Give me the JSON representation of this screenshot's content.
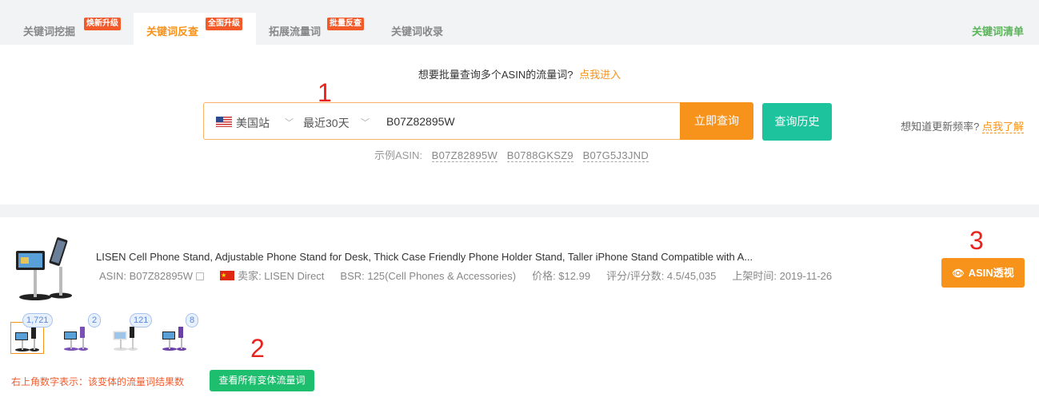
{
  "tabs": [
    {
      "label": "关键词挖掘",
      "badge": "焕新升级"
    },
    {
      "label": "关键词反查",
      "badge": "全面升级",
      "active": true
    },
    {
      "label": "拓展流量词",
      "badge": "批量反查"
    },
    {
      "label": "关键词收录"
    }
  ],
  "keyword_list_link": "关键词清单",
  "batch_tip": {
    "text": "想要批量查询多个ASIN的流量词?",
    "link": "点我进入"
  },
  "search": {
    "site": "美国站",
    "range": "最近30天",
    "asin_value": "B07Z82895W",
    "query_button": "立即查询",
    "history_button": "查询历史"
  },
  "freq_tip": {
    "text": "想知道更新频率?",
    "link": "点我了解"
  },
  "examples": {
    "label": "示例ASIN:",
    "items": [
      "B07Z82895W",
      "B0788GKSZ9",
      "B07G5J3JND"
    ]
  },
  "annotations": [
    "1",
    "2",
    "3"
  ],
  "product": {
    "title": "LISEN Cell Phone Stand, Adjustable Phone Stand for Desk, Thick Case Friendly Phone Holder Stand, Taller iPhone Stand Compatible with A...",
    "asin": "ASIN: B07Z82895W",
    "seller": "卖家: LISEN Direct",
    "bsr": "BSR: 125(Cell Phones & Accessories)",
    "price": "价格: $12.99",
    "rating": "评分/评分数: 4.5/45,035",
    "listed": "上架时间: 2019-11-26",
    "asin_button": "ASIN透视"
  },
  "variants": [
    {
      "count": "1,721",
      "color": "#222222",
      "selected": true
    },
    {
      "count": "2",
      "color": "#7a4fb8"
    },
    {
      "count": "121",
      "color": "#dddddd"
    },
    {
      "count": "8",
      "color": "#6a3fa8"
    }
  ],
  "variant_tip": "右上角数字表示：该变体的流量词结果数",
  "variants_button": "查看所有变体流量词",
  "colors": {
    "accent": "#f7921b",
    "teal": "#1dc39c",
    "green": "#1dbf6f",
    "badge": "#f25a2a",
    "annotation": "#e8231c"
  }
}
